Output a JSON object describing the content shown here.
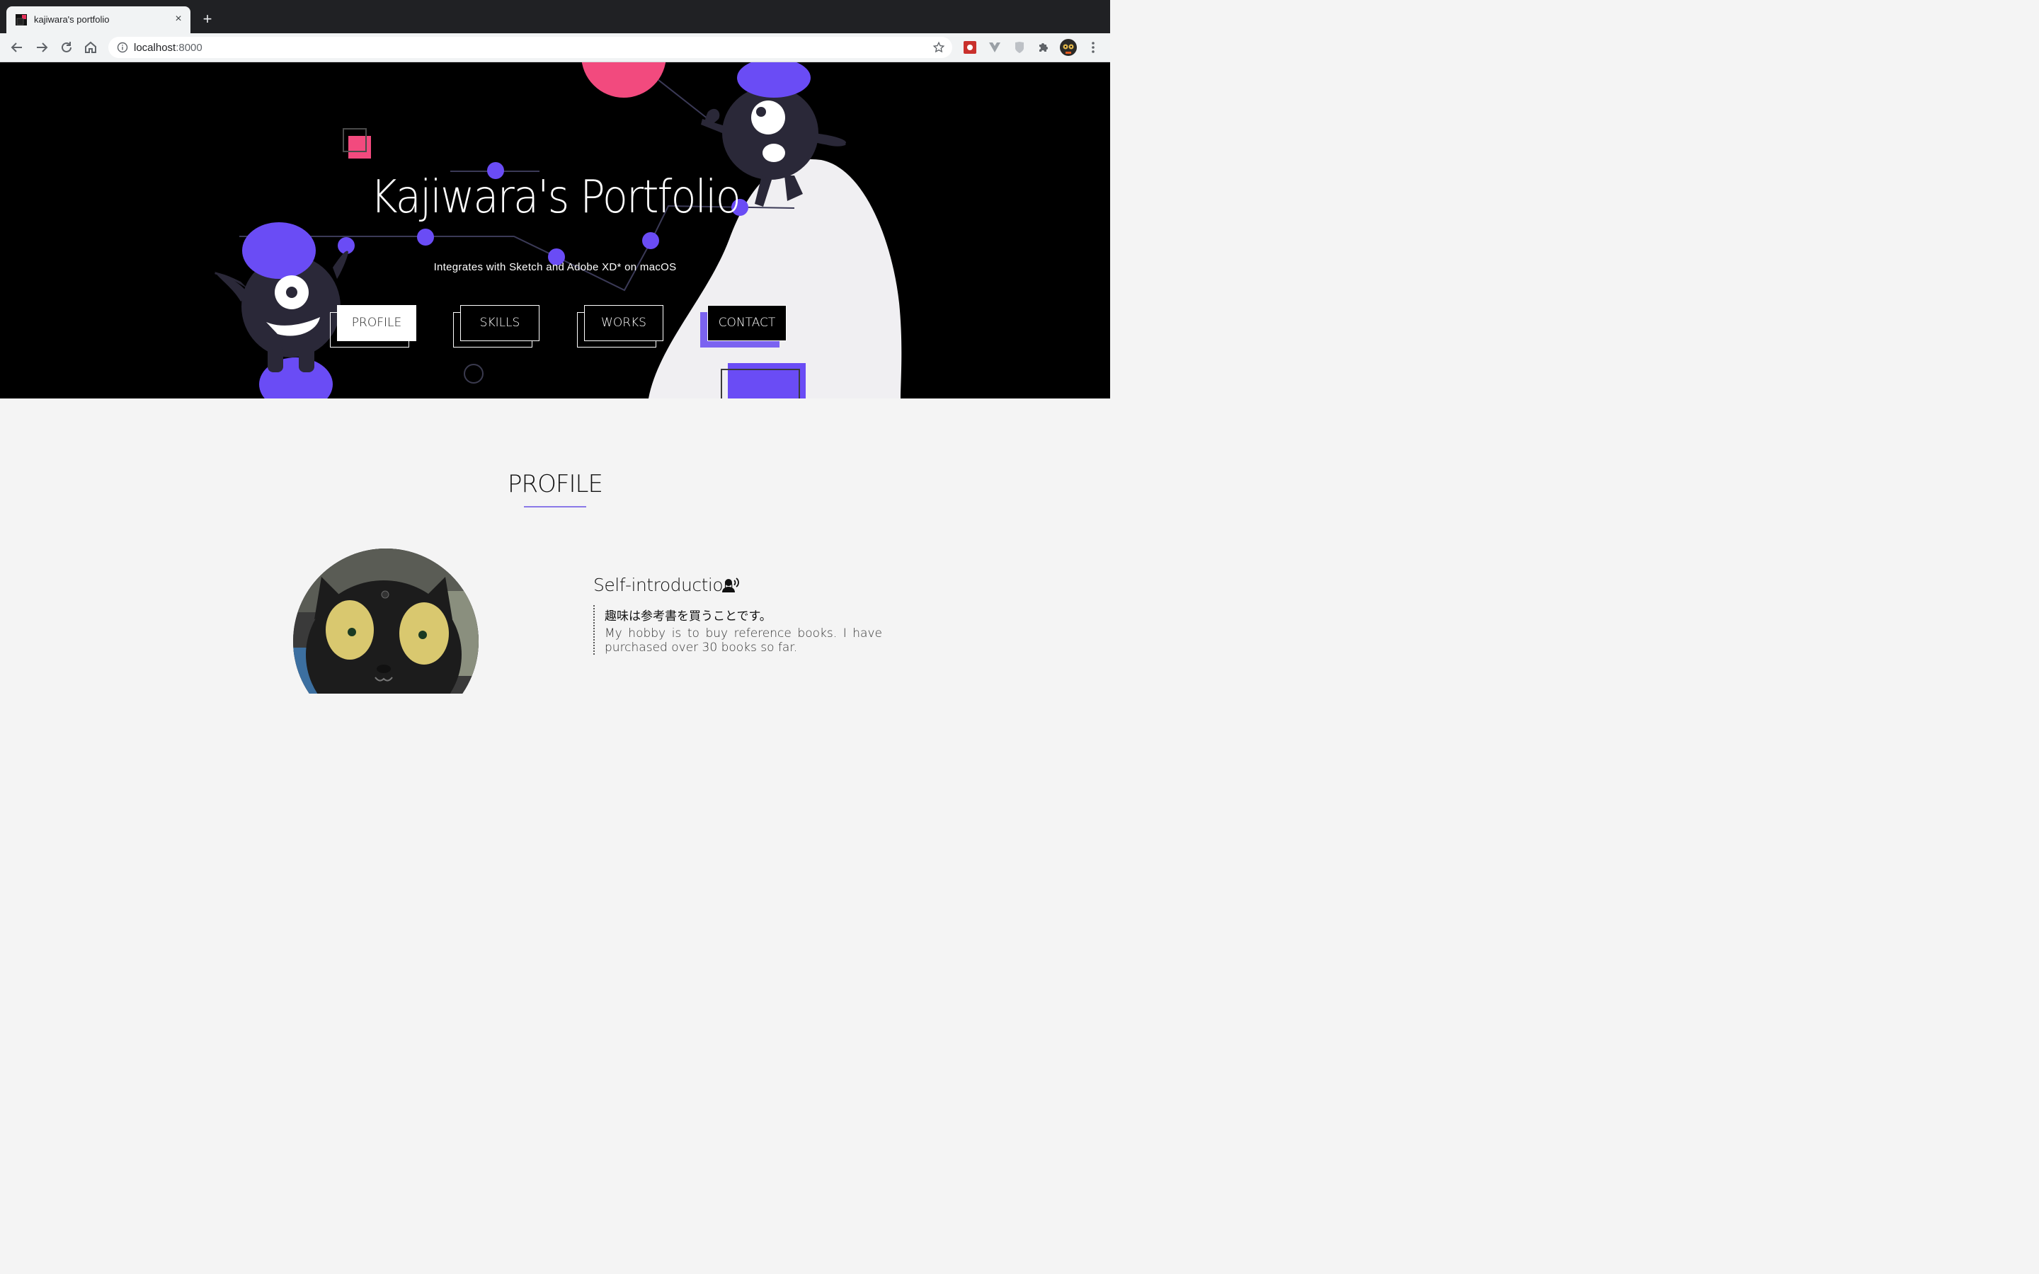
{
  "browser": {
    "tab_title": "kajiwara's portfolio",
    "url_host": "localhost",
    "url_port": ":8000",
    "new_tab_symbol": "+",
    "close_symbol": "×"
  },
  "hero": {
    "title": "Kajiwara's Portfolio",
    "subtitle": "Integrates with Sketch and Adobe XD* on macOS",
    "nav_buttons": [
      {
        "label": "PROFILE"
      },
      {
        "label": "SKILLS"
      },
      {
        "label": "WORKS"
      },
      {
        "label": "CONTACT"
      }
    ]
  },
  "profile": {
    "heading": "PROFILE",
    "intro_title": "Self-introduction",
    "intro_jp": "趣味は参考書を買うことです。",
    "intro_en": "My hobby is to buy reference books. I have purchased over 30 books so far."
  },
  "colors": {
    "accent_purple": "#6a4cf5",
    "accent_pink": "#f24a7e",
    "hero_bg": "#000000",
    "page_bg": "#f4f4f4"
  },
  "icons": [
    "back-icon",
    "forward-icon",
    "reload-icon",
    "home-icon",
    "info-icon",
    "star-icon",
    "extension-icon",
    "puzzle-icon",
    "menu-dots-icon",
    "speaking-person-icon"
  ]
}
